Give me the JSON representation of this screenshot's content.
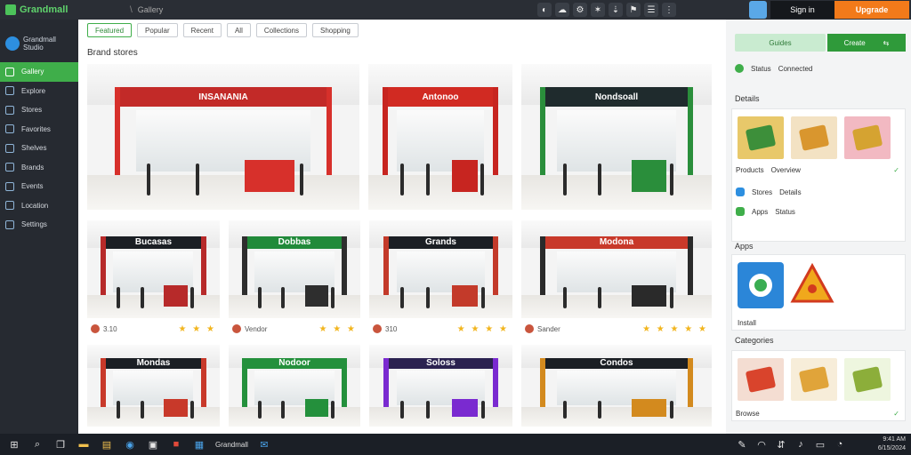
{
  "app": {
    "title": "Grandmall",
    "crumb_sep": "\\",
    "crumb": "Gallery"
  },
  "topbar": {
    "icons": [
      {
        "name": "toggle-icon",
        "glyph": "◐"
      },
      {
        "name": "cloud-icon",
        "glyph": "☁"
      },
      {
        "name": "settings-icon",
        "glyph": "⚙"
      },
      {
        "name": "share-icon",
        "glyph": "✶"
      },
      {
        "name": "pin-icon",
        "glyph": "⇣"
      },
      {
        "name": "flag-icon",
        "glyph": "⚑"
      },
      {
        "name": "list-icon",
        "glyph": "☰"
      },
      {
        "name": "more-icon",
        "glyph": "⋮"
      }
    ],
    "account_label": "Sign in",
    "cta_label": "Upgrade"
  },
  "sidebar": {
    "logo_line1": "Grandmall",
    "logo_line2": "Studio",
    "items": [
      {
        "label": "Gallery",
        "icon": "home-icon",
        "active": true
      },
      {
        "label": "Explore",
        "icon": "compass-icon",
        "active": false
      },
      {
        "label": "Stores",
        "icon": "store-icon",
        "active": false
      },
      {
        "label": "Favorites",
        "icon": "heart-icon",
        "active": false
      },
      {
        "label": "Shelves",
        "icon": "shelf-icon",
        "active": false
      },
      {
        "label": "Brands",
        "icon": "tag-icon",
        "active": false
      },
      {
        "label": "Events",
        "icon": "calendar-icon",
        "active": false
      },
      {
        "label": "Location",
        "icon": "location-icon",
        "active": false
      },
      {
        "label": "Settings",
        "icon": "gear-icon",
        "active": false
      }
    ]
  },
  "filters": [
    {
      "label": "Featured",
      "active": true
    },
    {
      "label": "Popular",
      "active": false
    },
    {
      "label": "Recent",
      "active": false
    },
    {
      "label": "All",
      "active": false
    },
    {
      "label": "Collections",
      "active": false
    },
    {
      "label": "Shopping",
      "active": false
    }
  ],
  "section_title": "Brand stores",
  "gallery": {
    "row1": [
      {
        "sign": "INSANANIA",
        "sign_color": "#c22a28",
        "accent": "#d7302b"
      },
      {
        "sign": "Antonoo",
        "sign_color": "#d12a22",
        "accent": "#c72520"
      },
      {
        "sign": "Nondsoall",
        "sign_color": "#1f2b2d",
        "accent": "#2a8e3b"
      }
    ],
    "row2": [
      {
        "sign": "Bucasas",
        "sign_color": "#1b1f24",
        "accent": "#b72a2a",
        "author": "3.10",
        "stars": "★ ★ ★",
        "rating": 3
      },
      {
        "sign": "Dobbas",
        "sign_color": "#218a3a",
        "accent": "#2e2e2e",
        "author": "Vendor",
        "stars": "★ ★ ★",
        "rating": 3
      },
      {
        "sign": "Grands",
        "sign_color": "#1b1f24",
        "accent": "#c33a2a",
        "author": "310",
        "stars": "★ ★ ★ ★",
        "rating": 4
      },
      {
        "sign": "Modona",
        "sign_color": "#c8392a",
        "accent": "#2a2a2a",
        "author": "Sander",
        "stars": "★ ★ ★ ★ ★",
        "rating": 5
      }
    ],
    "row3": [
      {
        "sign": "Mondas",
        "sign_color": "#1b1f24",
        "accent": "#c8392a"
      },
      {
        "sign": "Nodoor",
        "sign_color": "#24903c",
        "accent": "#24903c"
      },
      {
        "sign": "Soloss",
        "sign_color": "#2b2250",
        "accent": "#7a2ad0"
      },
      {
        "sign": "Condos",
        "sign_color": "#1b1f24",
        "accent": "#d38a1e"
      }
    ]
  },
  "rpanel": {
    "btn_secondary": "Guides",
    "btn_primary": "Create",
    "btn_primary_icon": "⇆",
    "status_label": "Status",
    "status_value": "Connected",
    "section1": "Details",
    "products": [
      {
        "color": "#e8c86a",
        "inner": "#3d8f3a"
      },
      {
        "color": "#f3e2c3",
        "inner": "#d9962e"
      },
      {
        "color": "#f2b9c2",
        "inner": "#d5a331"
      }
    ],
    "products_caption": "Products",
    "products_caption2": "Overview",
    "products_check": "✓",
    "rows": [
      {
        "label": "Stores",
        "value": "Details",
        "color": "#2d8fe0"
      },
      {
        "label": "Apps",
        "value": "Status",
        "color": "#3fae4a"
      }
    ],
    "section2": "Apps",
    "apps_caption": "Install",
    "section3": "Categories",
    "extras": [
      {
        "color": "#f4ddd2",
        "inner": "#d9442c"
      },
      {
        "color": "#f7edd9",
        "inner": "#e0a43a"
      },
      {
        "color": "#eef6df",
        "inner": "#8cae3a"
      }
    ],
    "extras_caption": "Browse",
    "extras_check": "✓"
  },
  "taskbar": {
    "app_label": "Grandmall",
    "time": "9:41 AM",
    "date": "6/15/2024"
  }
}
